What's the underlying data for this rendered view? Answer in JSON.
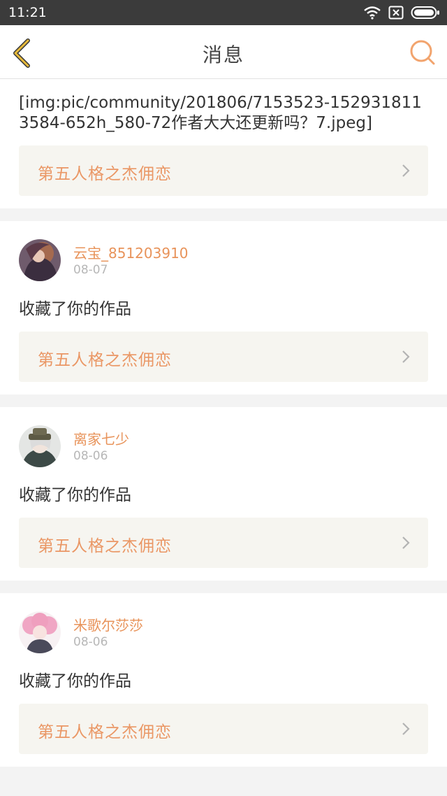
{
  "status_bar": {
    "time": "11:21"
  },
  "header": {
    "title": "消息"
  },
  "first_message": {
    "text": "[img:pic/community/201806/7153523-1529318113584-652h_580-72作者大大还更新吗？7.jpeg]",
    "work_title": "第五人格之杰佣恋"
  },
  "messages": [
    {
      "username": "云宝_851203910",
      "date": "08-07",
      "action": "收藏了你的作品",
      "work_title": "第五人格之杰佣恋"
    },
    {
      "username": "离家七少",
      "date": "08-06",
      "action": "收藏了你的作品",
      "work_title": "第五人格之杰佣恋"
    },
    {
      "username": "米歌尔莎莎",
      "date": "08-06",
      "action": "收藏了你的作品",
      "work_title": "第五人格之杰佣恋"
    }
  ],
  "colors": {
    "accent": "#e8935a",
    "back_icon": "#e6b93a",
    "status_bar": "#3b3b3b"
  }
}
